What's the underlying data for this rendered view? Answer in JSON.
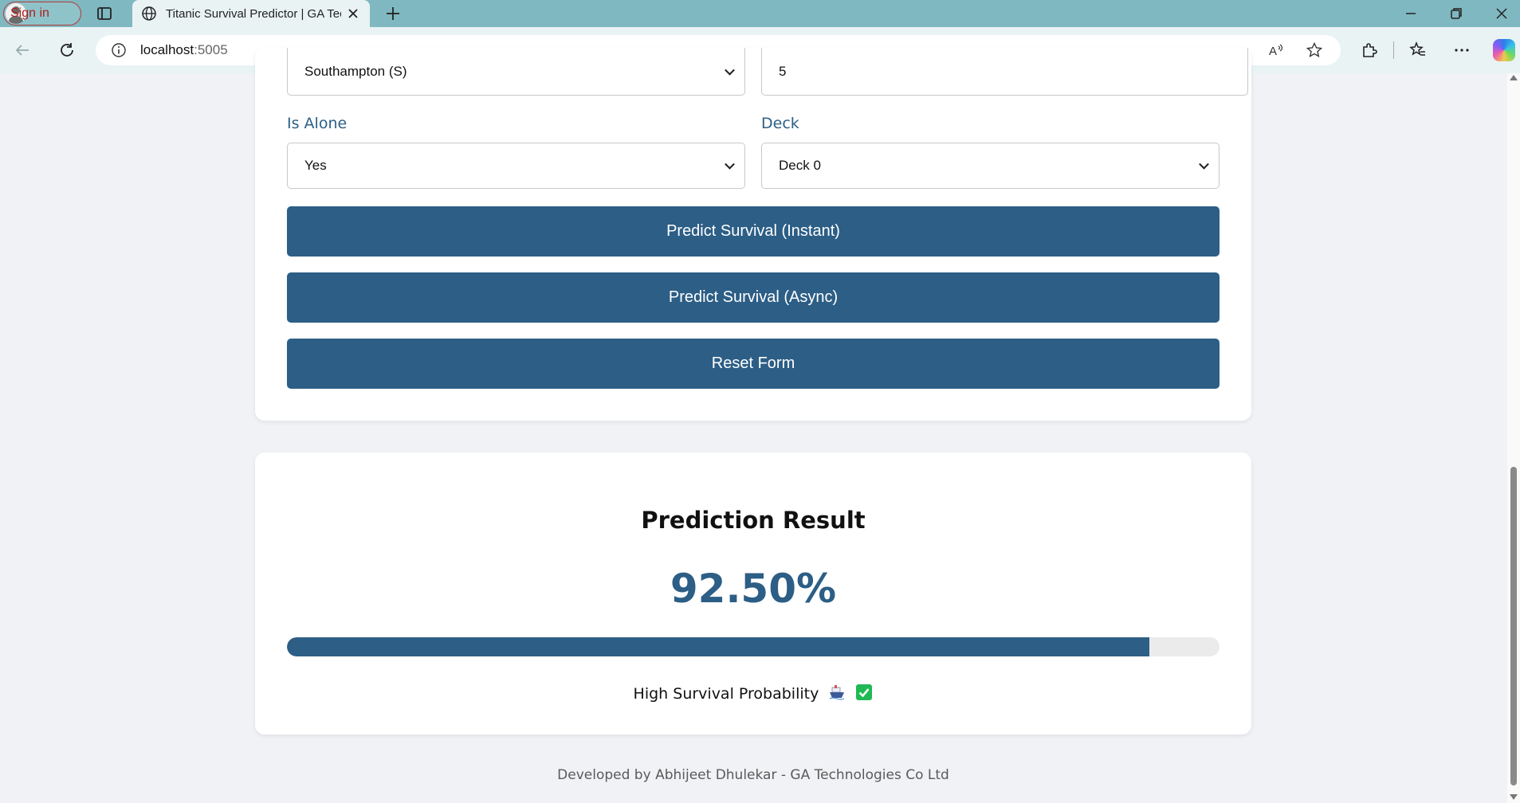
{
  "browser": {
    "signin_label": "Sign in",
    "tab_title": "Titanic Survival Predictor | GA Technologies",
    "url_host": "localhost",
    "url_port": ":5005"
  },
  "form": {
    "embarked": {
      "value": "Southampton (S)"
    },
    "partial_number": {
      "value": "5"
    },
    "is_alone": {
      "label": "Is Alone",
      "value": "Yes"
    },
    "deck": {
      "label": "Deck",
      "value": "Deck 0"
    },
    "buttons": {
      "predict_instant": "Predict Survival (Instant)",
      "predict_async": "Predict Survival (Async)",
      "reset": "Reset Form"
    }
  },
  "result": {
    "title": "Prediction Result",
    "percentage_text": "92.50%",
    "probability": 0.925,
    "message": "High Survival Probability",
    "icons": [
      "ship-icon",
      "check-icon"
    ]
  },
  "footer": {
    "text": "Developed by Abhijeet Dhulekar - GA Technologies Co Ltd"
  },
  "colors": {
    "primary": "#2c5e86",
    "label": "#2c5f87",
    "page_bg": "#f0f2f5",
    "success": "#1fb954"
  }
}
